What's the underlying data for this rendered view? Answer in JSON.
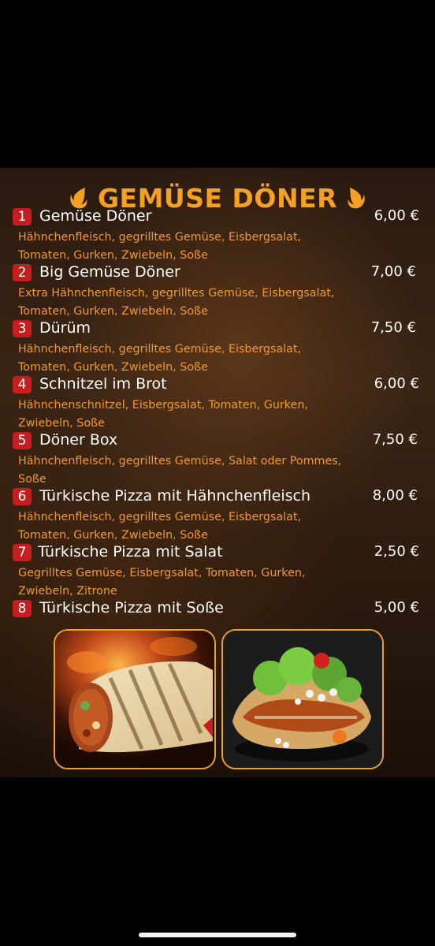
{
  "menu": {
    "title": "GEMÜSE DÖNER",
    "items": [
      {
        "num": "1",
        "name": "Gemüse Döner",
        "price": "6,00 €",
        "desc": "Hähnchenfleisch, gegrilltes Gemüse, Eisbergsalat, Tomaten, Gurken, Zwiebeln, Soße"
      },
      {
        "num": "2",
        "name": "Big Gemüse Döner",
        "price": "7,00 €",
        "desc": "Extra Hähnchenfleisch, gegrilltes Gemüse, Eisbergsalat, Tomaten, Gurken, Zwiebeln, Soße"
      },
      {
        "num": "3",
        "name": "Dürüm",
        "price": "7,50 €",
        "desc": "Hähnchenfleisch, gegrilltes Gemüse, Eisbergsalat, Tomaten, Gurken, Zwiebeln, Soße"
      },
      {
        "num": "4",
        "name": "Schnitzel im Brot",
        "price": "6,00 €",
        "desc": "Hähnchenschnitzel, Eisbergsalat, Tomaten, Gurken, Zwiebeln, Soße"
      },
      {
        "num": "5",
        "name": "Döner Box",
        "price": "7,50 €",
        "desc": "Hähnchenfleisch, gegrilltes Gemüse, Salat oder Pommes, Soße"
      },
      {
        "num": "6",
        "name": "Türkische Pizza mit Hähnchenfleisch",
        "price": "8,00 €",
        "desc": "Hähnchenfleisch, gegrilltes Gemüse, Eisbergsalat, Tomaten, Gurken, Zwiebeln, Soße"
      },
      {
        "num": "7",
        "name": "Türkische Pizza mit Salat",
        "price": "2,50 €",
        "desc": "Gegrilltes Gemüse, Eisbergsalat, Tomaten, Gurken, Zwiebeln, Zitrone"
      },
      {
        "num": "8",
        "name": "Türkische Pizza mit Soße",
        "price": "5,00 €",
        "desc": ""
      }
    ]
  },
  "colors": {
    "accent": "#f5a020",
    "badge": "#c61e1e",
    "description": "#f09a2a",
    "frame": "#e8a428"
  },
  "icons": [
    "flame-icon-left",
    "flame-icon-right"
  ]
}
